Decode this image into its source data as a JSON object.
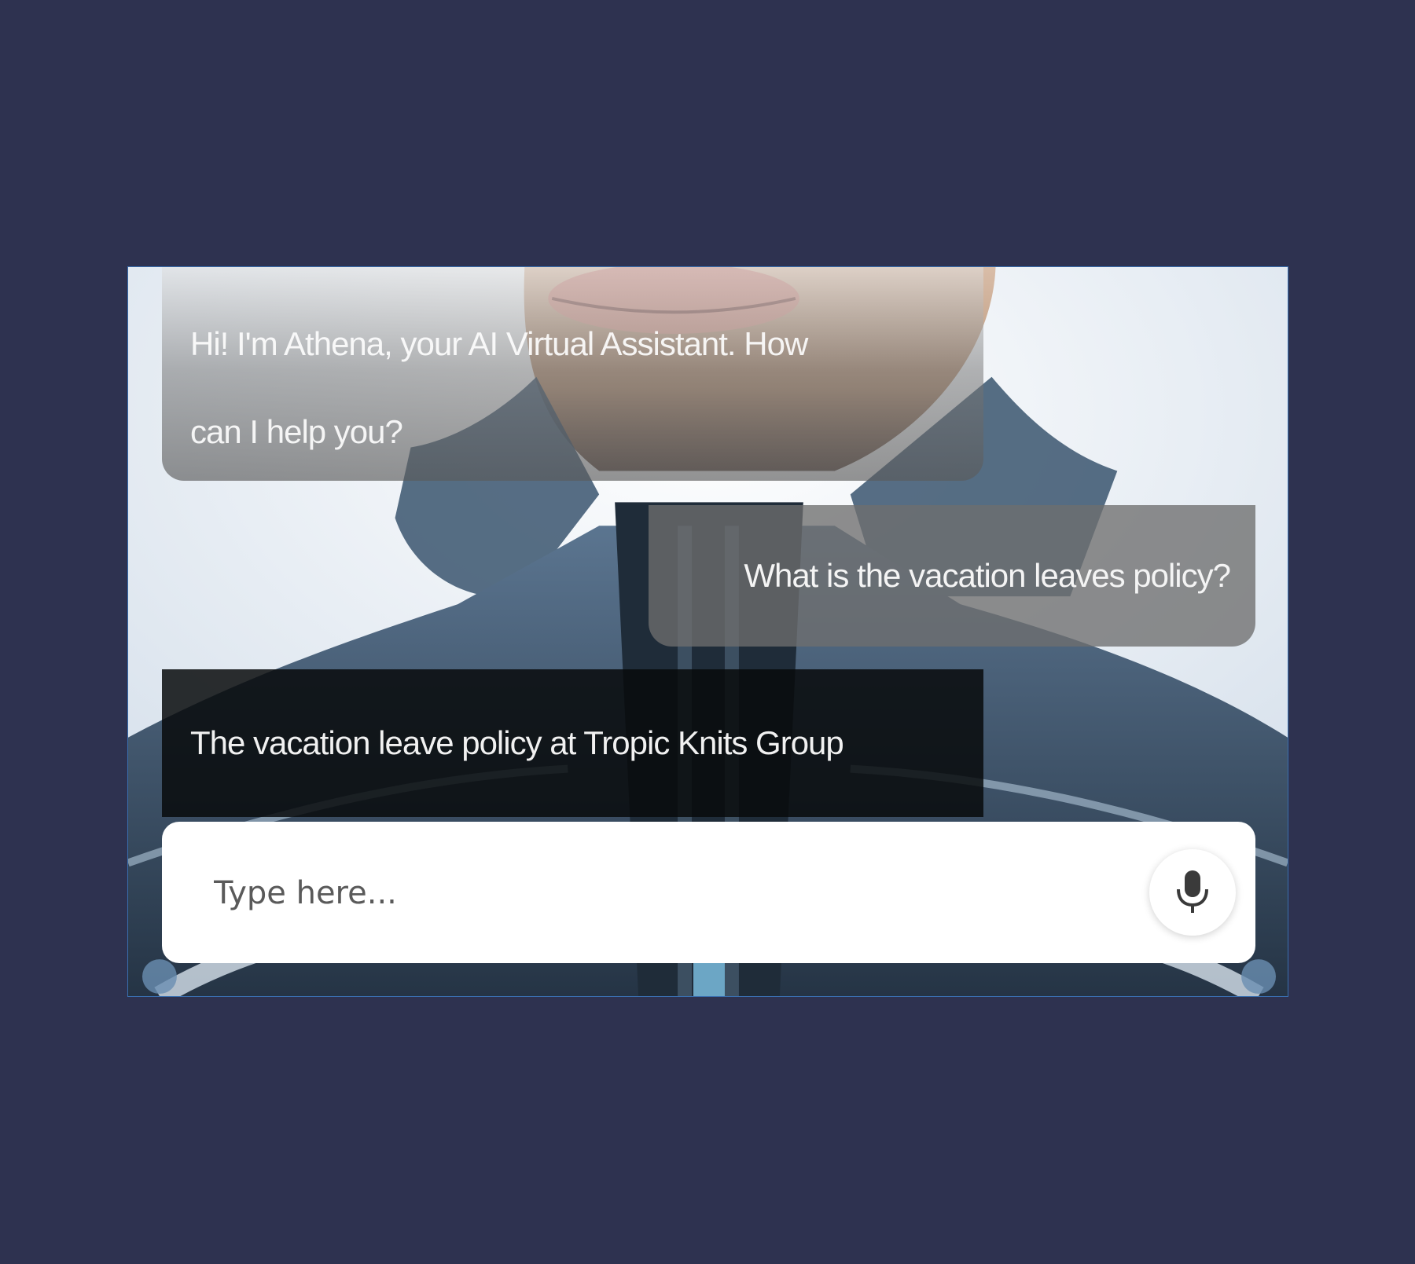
{
  "chat": {
    "messages": [
      {
        "role": "assistant",
        "lines": [
          "Hi! I'm Athena, your AI Virtual Assistant. How",
          "can I help you?"
        ]
      },
      {
        "role": "user",
        "text": "What is the vacation leaves policy?"
      },
      {
        "role": "assistant",
        "text": "The vacation leave policy at Tropic Knits Group"
      }
    ]
  },
  "composer": {
    "placeholder": "Type here...",
    "value": "",
    "mic_icon": "microphone-icon"
  },
  "colors": {
    "page_background": "#2e3250",
    "input_background": "#ffffff",
    "mic_icon": "#3a3a3a"
  }
}
